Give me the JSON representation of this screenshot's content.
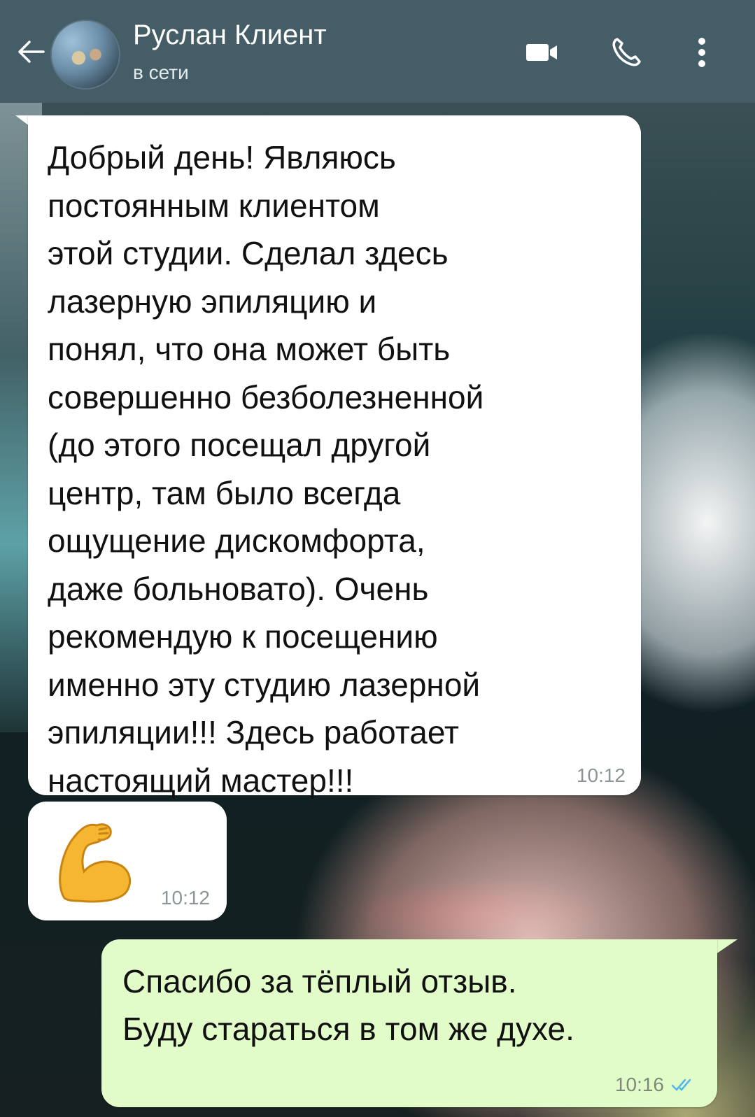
{
  "header": {
    "back_icon": "arrow-left-icon",
    "contact_name": "Руслан Клиент",
    "status": "в сети",
    "actions": [
      "video-call-icon",
      "phone-icon",
      "more-vert-icon"
    ],
    "colors": {
      "bar": "#455d66",
      "text": "#ffffff"
    }
  },
  "messages": [
    {
      "direction": "incoming",
      "text": "Добрый день! Являюсь\nпостоянным клиентом\nэтой студии. Сделал здесь\nлазерную эпиляцию и\nпонял, что она может быть\nсовершенно безболезненной\n(до этого посещал другой\nцентр, там было всегда\nощущение дискомфорта,\nдаже больновато). Очень\nрекомендую к посещению\nименно эту студию лазерной\nэпиляции!!! Здесь работает\nнастоящий мастер!!!",
      "time": "10:12"
    },
    {
      "direction": "incoming",
      "emoji": "flexed-biceps-icon",
      "time": "10:12"
    },
    {
      "direction": "outgoing",
      "text": "Спасибо за тёплый отзыв.\nБуду стараться в том же духе.",
      "time": "10:16",
      "status_icon": "double-check-icon"
    }
  ],
  "colors": {
    "incoming_bubble": "#ffffff",
    "outgoing_bubble": "#e2fcc9",
    "read_check": "#4fb6ec"
  }
}
